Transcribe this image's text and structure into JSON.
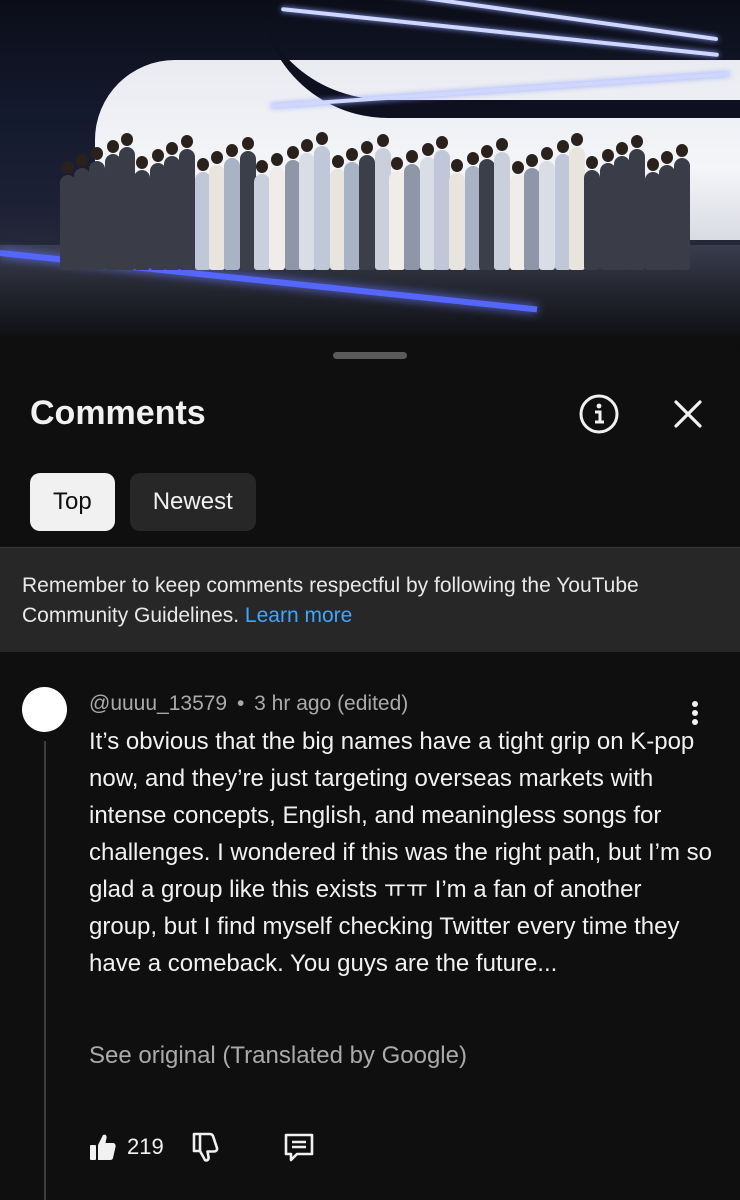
{
  "video": {
    "description_icon": "video-thumbnail"
  },
  "comments_panel": {
    "title": "Comments",
    "info_icon": "info-icon",
    "close_icon": "close-icon",
    "sort_chips": [
      {
        "label": "Top",
        "selected": true
      },
      {
        "label": "Newest",
        "selected": false
      }
    ],
    "guidelines_banner": {
      "text": "Remember to keep comments respectful by following the YouTube Community Guidelines. ",
      "link_label": "Learn more"
    }
  },
  "comment": {
    "author": "@uuuu_13579",
    "separator": "•",
    "time": "3 hr ago (edited)",
    "body": "It’s obvious that the big names have a tight grip on K-pop now, and they’re just targeting overseas markets with intense concepts, English, and meaningless songs for challenges. I wondered if this was the right path, but I’m so glad a group like this exists ㅠㅠ I’m a fan of another group, but I find myself checking Twitter every time they have a comeback. You guys are the future...",
    "see_original": "See original (Translated by Google)",
    "like_count": "219"
  },
  "colors": {
    "background": "#0f0f0f",
    "chip_active": "#f1f1f1",
    "chip_inactive": "#272727",
    "link": "#3ea6ff",
    "secondary_text": "#aaaaaa"
  }
}
